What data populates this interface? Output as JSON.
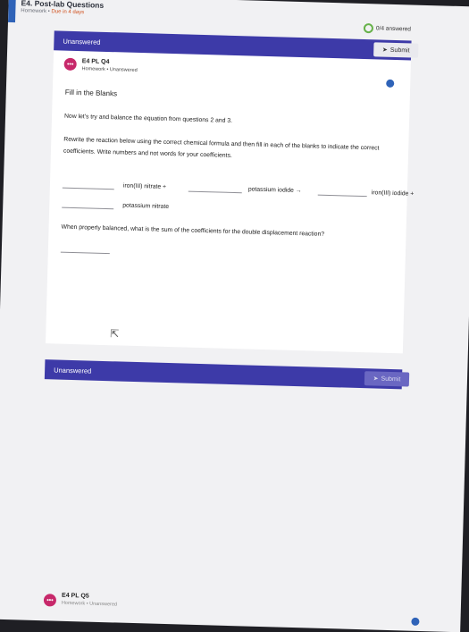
{
  "header": {
    "title": "E4. Post-lab Questions",
    "type": "Homework",
    "due": "Due in 4 days",
    "progress": "0/4 answered"
  },
  "question": {
    "status": "Unanswered",
    "submit_label": "Submit",
    "id": "E4 PL Q4",
    "type": "Homework",
    "answer_state": "Unanswered",
    "section_title": "Fill in the Blanks",
    "intro": "Now let's try and balance the equation from questions 2 and 3.",
    "instructions_line1": "Rewrite the reaction below using the correct chemical formula and then fill in each of the blanks to indicate the correct",
    "instructions_line2": "coefficients. Write numbers and not words for your coefficients.",
    "reaction": {
      "term1": "iron(III) nitrate +",
      "term2": "potassium iodide →",
      "term3": "iron(III) iodide +",
      "term4": "potassium nitrate"
    },
    "followup": "When properly balanced, what is the sum of the coefficients for the double displacement reaction?"
  },
  "next_question": {
    "status": "Unanswered",
    "submit_label": "Submit",
    "id": "E4 PL Q5",
    "type": "Homework",
    "answer_state": "Unanswered"
  },
  "icons": {
    "question_icon": "ellipsis-icon",
    "submit_icon": "paper-plane-icon",
    "cursor": "mouse-pointer-icon"
  },
  "colors": {
    "accent": "#3d3aa8",
    "due": "#d04e1a",
    "badge": "#c7286a",
    "progress": "#67b24a"
  }
}
